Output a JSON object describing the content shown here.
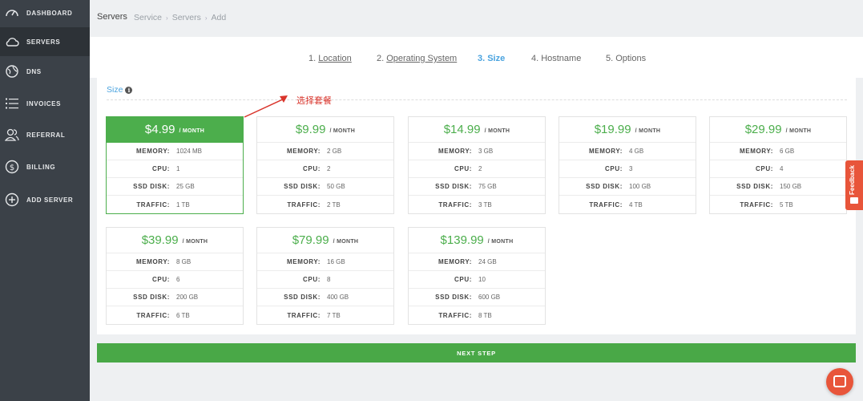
{
  "sidebar": {
    "items": [
      {
        "label": "DASHBOARD",
        "icon": "gauge-icon"
      },
      {
        "label": "SERVERS",
        "icon": "cloud-icon"
      },
      {
        "label": "DNS",
        "icon": "globe-icon"
      },
      {
        "label": "INVOICES",
        "icon": "list-icon"
      },
      {
        "label": "REFERRAL",
        "icon": "users-icon"
      },
      {
        "label": "BILLING",
        "icon": "dollar-icon"
      },
      {
        "label": "ADD SERVER",
        "icon": "plus-circle-icon"
      }
    ],
    "active_item": "SERVERS"
  },
  "header": {
    "title": "Servers",
    "breadcrumb": [
      "Service",
      "Servers",
      "Add"
    ]
  },
  "steps": [
    {
      "num": "1.",
      "label": "Location",
      "link": true
    },
    {
      "num": "2.",
      "label": "Operating System",
      "link": true
    },
    {
      "num": "3.",
      "label": "Size",
      "active": true
    },
    {
      "num": "4.",
      "label": "Hostname"
    },
    {
      "num": "5.",
      "label": "Options"
    }
  ],
  "panel": {
    "title": "Size",
    "annotation": "选择套餐"
  },
  "spec_labels": {
    "memory": "MEMORY:",
    "cpu": "CPU:",
    "ssd": "SSD DISK:",
    "traffic": "TRAFFIC:"
  },
  "period_label": "/ MONTH",
  "plans": [
    {
      "price": "$4.99",
      "memory": "1024 MB",
      "cpu": "1",
      "ssd": "25 GB",
      "traffic": "1 TB",
      "selected": true
    },
    {
      "price": "$9.99",
      "memory": "2 GB",
      "cpu": "2",
      "ssd": "50 GB",
      "traffic": "2 TB"
    },
    {
      "price": "$14.99",
      "memory": "3 GB",
      "cpu": "2",
      "ssd": "75 GB",
      "traffic": "3 TB"
    },
    {
      "price": "$19.99",
      "memory": "4 GB",
      "cpu": "3",
      "ssd": "100 GB",
      "traffic": "4 TB"
    },
    {
      "price": "$29.99",
      "memory": "6 GB",
      "cpu": "4",
      "ssd": "150 GB",
      "traffic": "5 TB"
    },
    {
      "price": "$39.99",
      "memory": "8 GB",
      "cpu": "6",
      "ssd": "200 GB",
      "traffic": "6 TB"
    },
    {
      "price": "$79.99",
      "memory": "16 GB",
      "cpu": "8",
      "ssd": "400 GB",
      "traffic": "7 TB"
    },
    {
      "price": "$139.99",
      "memory": "24 GB",
      "cpu": "10",
      "ssd": "600 GB",
      "traffic": "8 TB"
    }
  ],
  "next_button": "NEXT STEP",
  "feedback_tab": "Feedback",
  "colors": {
    "accent_green": "#4cae4c",
    "link_blue": "#4aa3df",
    "sidebar_bg": "#3b4148",
    "feedback_orange": "#e8553a",
    "annotation_red": "#d9342b"
  }
}
